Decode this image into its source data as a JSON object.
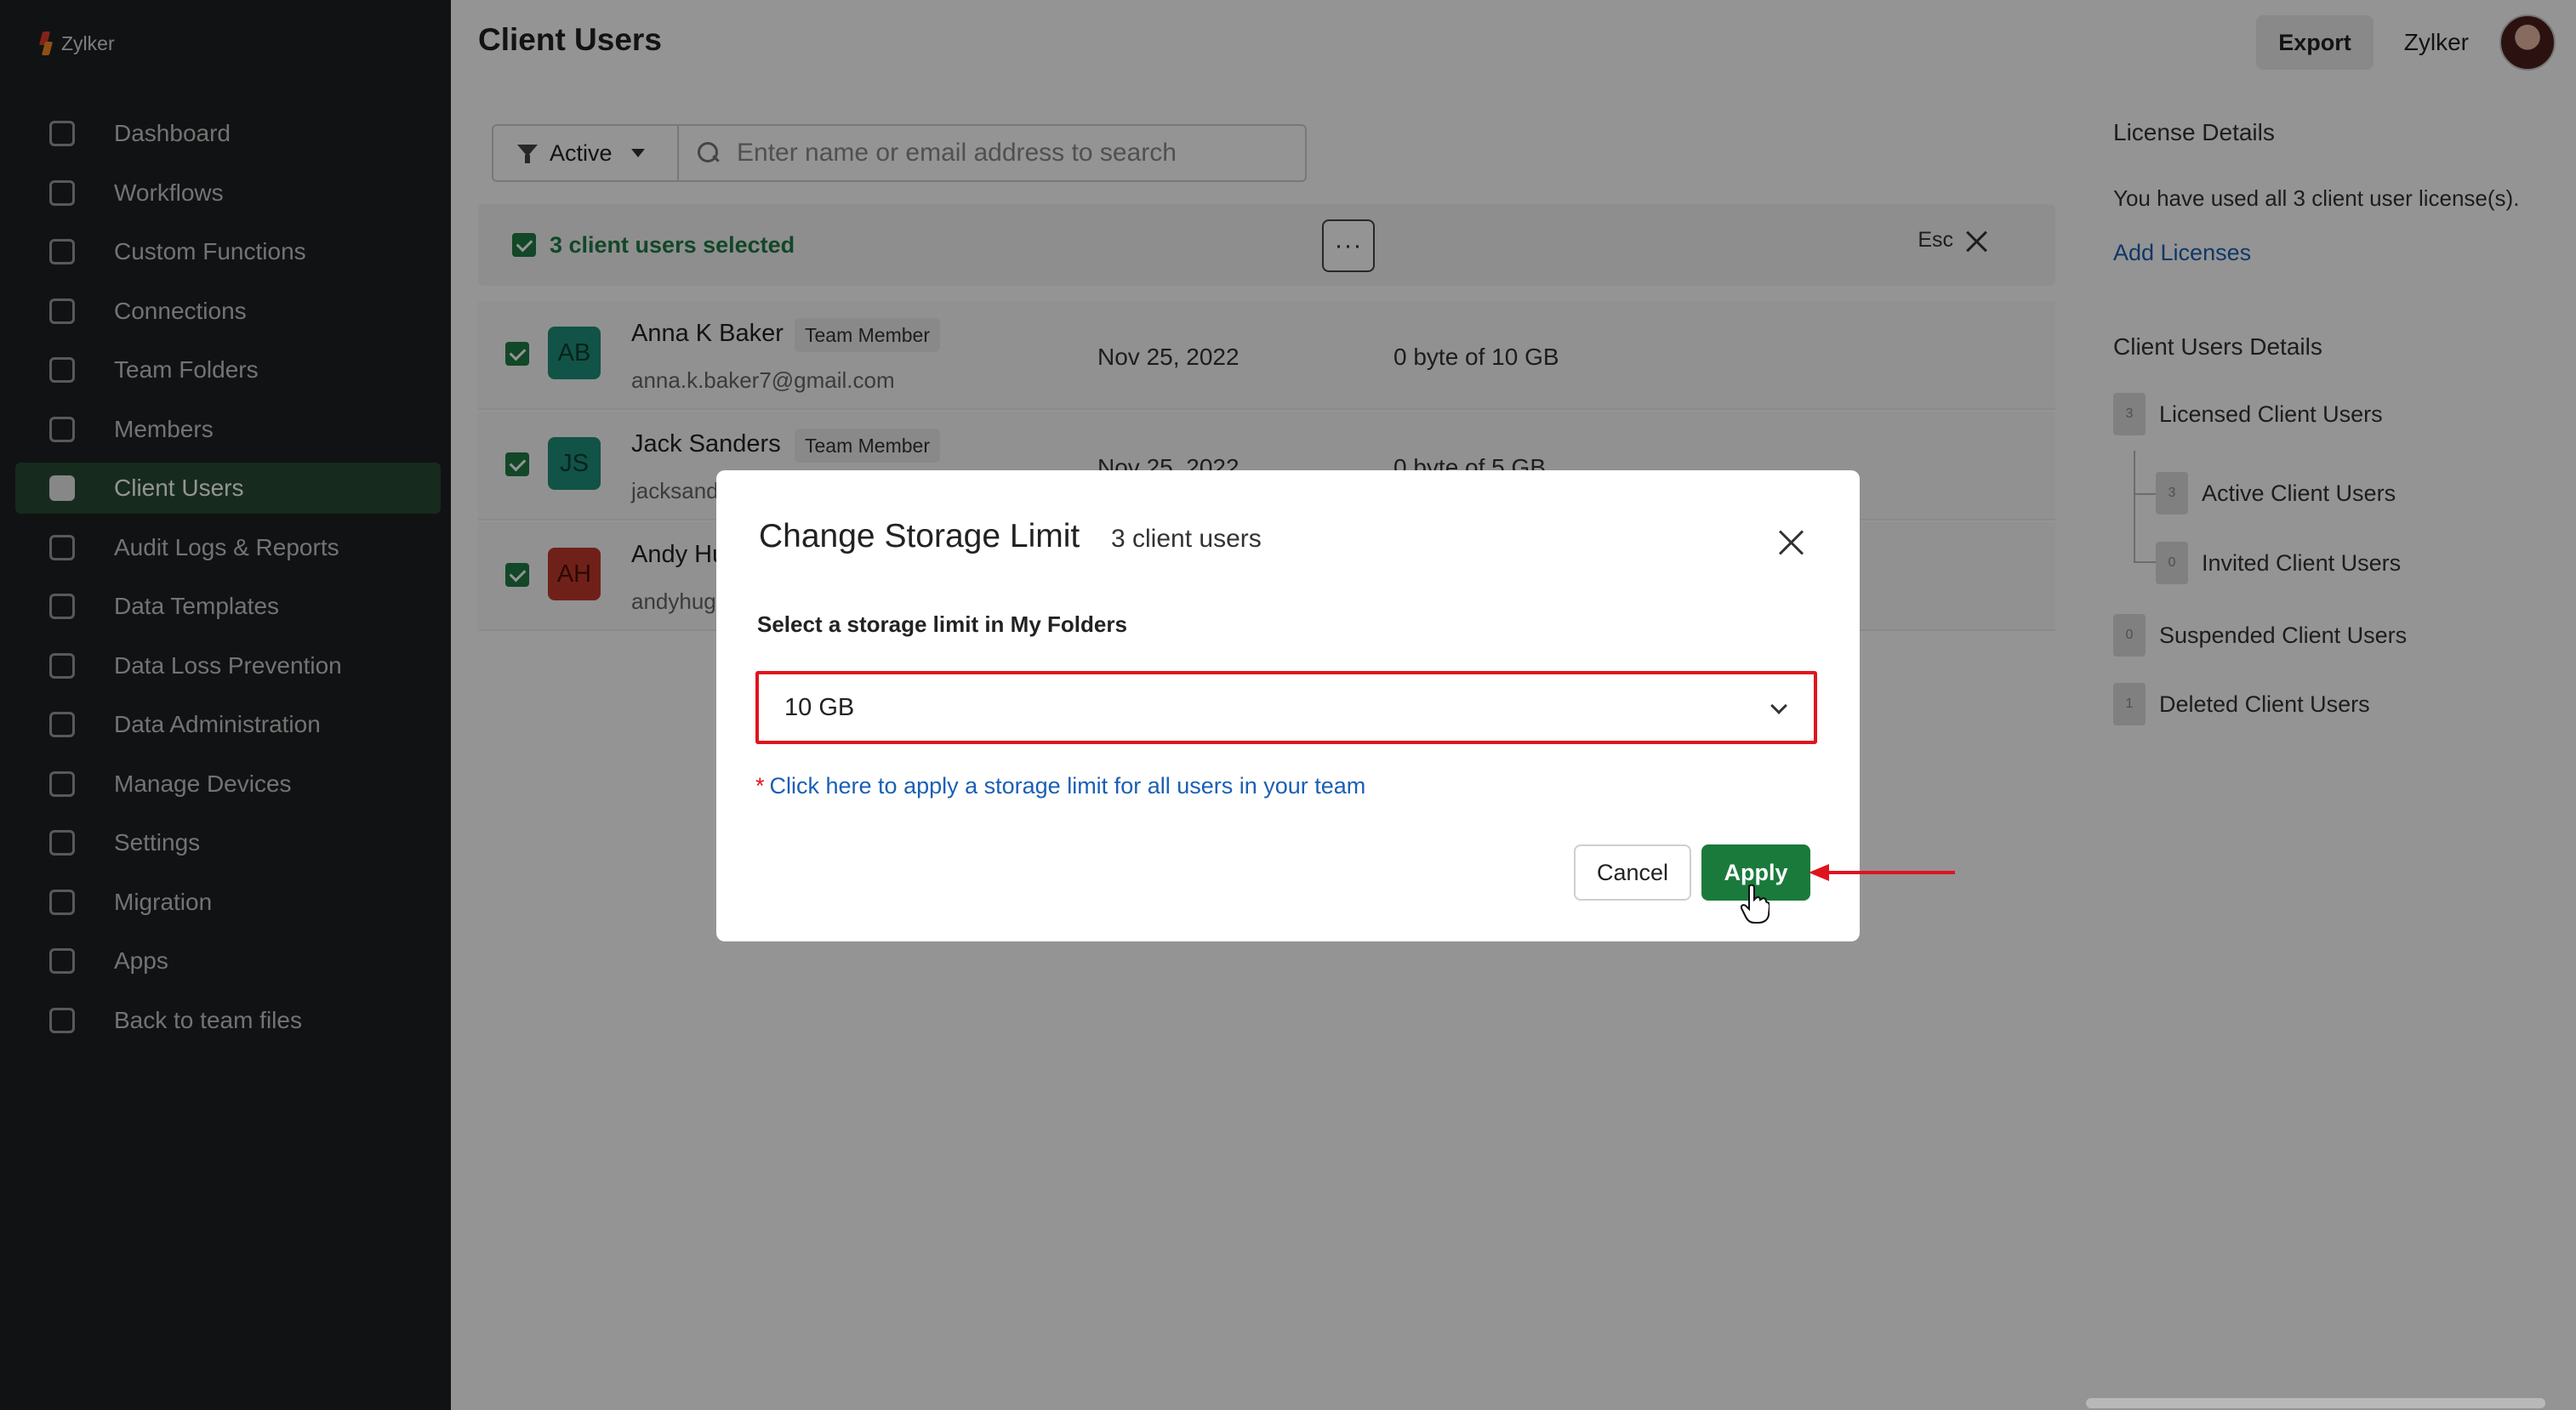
{
  "app": {
    "brand": "Zylker",
    "accent": "#1a7a3c",
    "highlight": "#e0141e"
  },
  "sidebar": {
    "items": [
      {
        "label": "Dashboard",
        "icon": "grid-icon"
      },
      {
        "label": "Workflows",
        "icon": "workflow-icon"
      },
      {
        "label": "Custom Functions",
        "icon": "code-icon"
      },
      {
        "label": "Connections",
        "icon": "plug-icon"
      },
      {
        "label": "Team Folders",
        "icon": "folder-icon"
      },
      {
        "label": "Members",
        "icon": "members-icon"
      },
      {
        "label": "Client Users",
        "icon": "client-user-icon",
        "active": true
      },
      {
        "label": "Audit Logs & Reports",
        "icon": "report-icon"
      },
      {
        "label": "Data Templates",
        "icon": "template-icon"
      },
      {
        "label": "Data Loss Prevention",
        "icon": "shield-icon"
      },
      {
        "label": "Data Administration",
        "icon": "database-icon"
      },
      {
        "label": "Manage Devices",
        "icon": "devices-icon"
      },
      {
        "label": "Settings",
        "icon": "gear-icon"
      },
      {
        "label": "Migration",
        "icon": "migration-icon"
      },
      {
        "label": "Apps",
        "icon": "apps-icon"
      },
      {
        "label": "Back to team files",
        "icon": "back-icon"
      }
    ]
  },
  "header": {
    "title": "Client Users",
    "export_label": "Export",
    "org_name": "Zylker"
  },
  "filter": {
    "status": "Active",
    "search_placeholder": "Enter name or email address to search"
  },
  "selection": {
    "text": "3 client users selected",
    "more": "···",
    "esc_label": "Esc"
  },
  "users": [
    {
      "initials": "AB",
      "name": "Anna K Baker",
      "role": "Team Member",
      "email": "anna.k.baker7@gmail.com",
      "date": "Nov 25, 2022",
      "storage": "0 byte of 10 GB",
      "color": "#1f8f7a"
    },
    {
      "initials": "JS",
      "name": "Jack Sanders",
      "role": "Team Member",
      "email": "jacksand",
      "date": "Nov 25, 2022",
      "storage": "0 byte of 5 GB",
      "color": "#1f8f7a"
    },
    {
      "initials": "AH",
      "name": "Andy Hu",
      "role": "",
      "email": "andyhug",
      "date": "",
      "storage": "",
      "color": "#c0392b"
    }
  ],
  "right_panel": {
    "license_heading": "License Details",
    "license_text": "You have used all 3 client user license(s).",
    "add_licenses": "Add Licenses",
    "details_heading": "Client Users Details",
    "stats": [
      {
        "count": "3",
        "label": "Licensed Client Users"
      },
      {
        "count": "3",
        "label": "Active Client Users"
      },
      {
        "count": "0",
        "label": "Invited Client Users"
      },
      {
        "count": "0",
        "label": "Suspended Client Users"
      },
      {
        "count": "1",
        "label": "Deleted Client Users"
      }
    ]
  },
  "modal": {
    "title": "Change Storage Limit",
    "subtitle": "3 client users",
    "field_label": "Select a storage limit in My Folders",
    "selected_value": "10 GB",
    "hint_required": "*",
    "hint": "Click here to apply a storage limit for all users in your team",
    "cancel_label": "Cancel",
    "apply_label": "Apply"
  }
}
